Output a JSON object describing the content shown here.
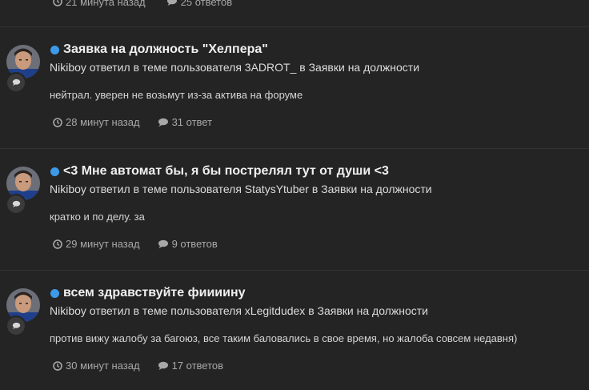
{
  "top_meta": {
    "time": "21 минута назад",
    "replies": "25 ответов"
  },
  "items": [
    {
      "title": "Заявка на должность \"Хелпера\"",
      "author": "Nikiboy",
      "action": "ответил в теме пользователя",
      "topic_author": "3ADROT_",
      "in_word": "в",
      "forum": "Заявки на должности",
      "snippet": "нейтрал. уверен не возьмут из-за актива на форуме",
      "time": "28 минут назад",
      "replies": "31 ответ"
    },
    {
      "title": "<3 Мне автомат бы, я бы пострелял тут от души <3",
      "author": "Nikiboy",
      "action": "ответил в теме пользователя",
      "topic_author": "StatysYtuber",
      "in_word": "в",
      "forum": "Заявки на должности",
      "snippet": "кратко и по делу. за",
      "time": "29 минут назад",
      "replies": "9 ответов"
    },
    {
      "title": "всем здравствуйте фиииину",
      "author": "Nikiboy",
      "action": "ответил в теме пользователя",
      "topic_author": "xLegitdudex",
      "in_word": "в",
      "forum": "Заявки на должности",
      "snippet": "против вижу жалобу за багоюз, все таким баловались в свое время, но жалоба совсем недавня)",
      "time": "30 минут назад",
      "replies": "17 ответов"
    }
  ],
  "colors": {
    "background": "#242424",
    "unread_dot": "#3d9ae8",
    "divider": "#333333"
  },
  "icons": {
    "time": "clock-icon",
    "replies": "comment-icon",
    "badge": "comment-icon"
  }
}
